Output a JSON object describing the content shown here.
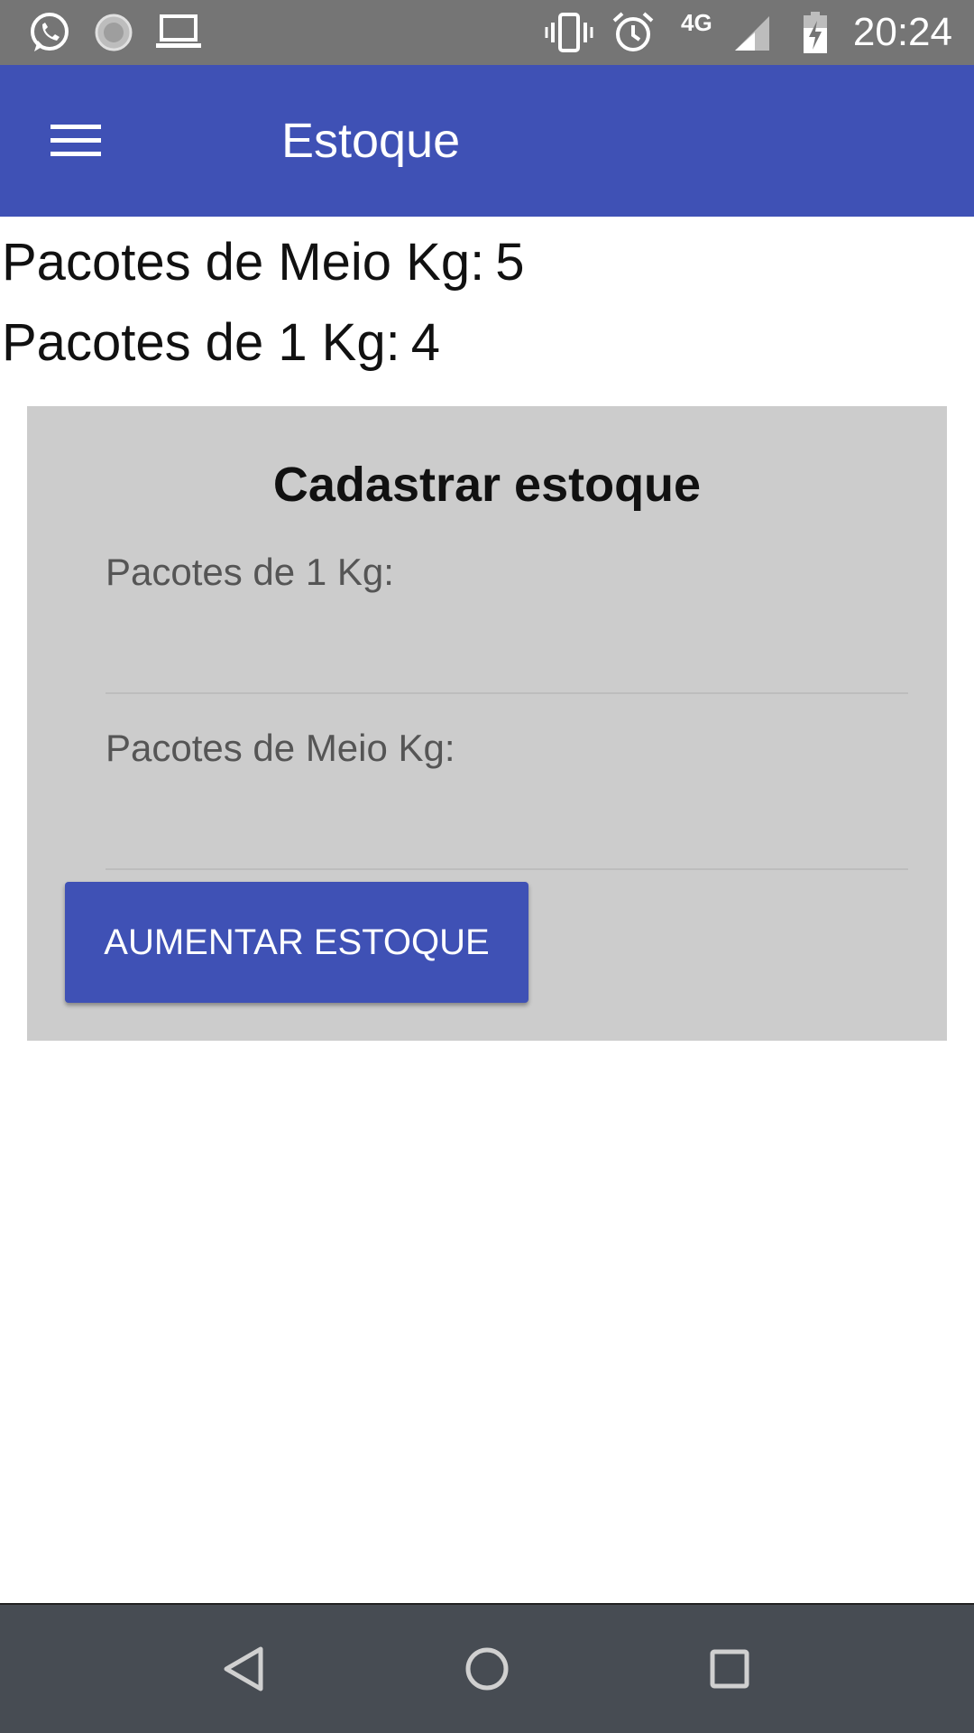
{
  "status_bar": {
    "time": "20:24",
    "network": "4G",
    "icons": [
      "whatsapp-icon",
      "loading-icon",
      "laptop-icon",
      "vibrate-icon",
      "alarm-icon",
      "signal-icon",
      "battery-charging-icon"
    ]
  },
  "app_bar": {
    "title": "Estoque",
    "menu_icon": "hamburger-menu-icon",
    "color": "#3f51b5"
  },
  "stock": {
    "half_kg_label": "Pacotes de Meio Kg:",
    "half_kg_value": "5",
    "one_kg_label": "Pacotes de 1 Kg:",
    "one_kg_value": "4"
  },
  "form": {
    "title": "Cadastrar estoque",
    "field_one_kg_placeholder": "Pacotes de 1 Kg:",
    "field_one_kg_value": "",
    "field_half_kg_placeholder": "Pacotes de Meio Kg:",
    "field_half_kg_value": "",
    "submit_label": "AUMENTAR ESTOQUE",
    "background": "#cccccc"
  },
  "nav_bar": {
    "icons": [
      "back-icon",
      "home-icon",
      "recents-icon"
    ]
  }
}
